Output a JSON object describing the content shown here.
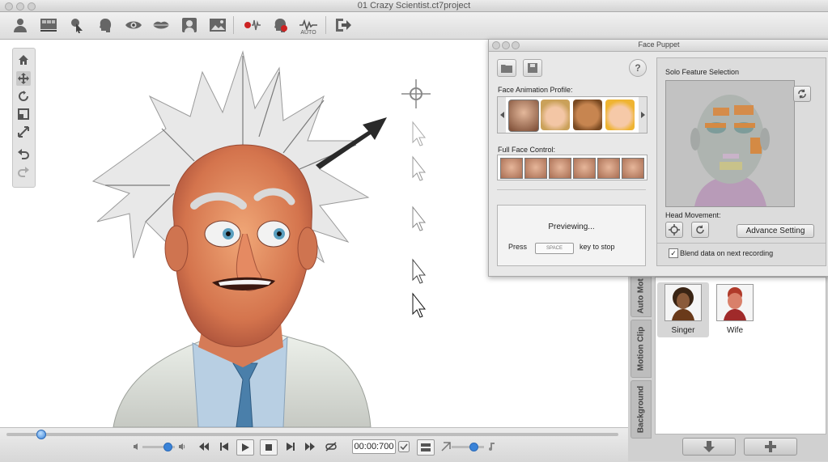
{
  "window": {
    "title": "01 Crazy Scientist.ct7project"
  },
  "toolbar": {
    "icons": [
      "actor-icon",
      "scene-icon",
      "pointer-puppet-icon",
      "head-icon",
      "eye-icon",
      "lips-icon",
      "portrait-icon",
      "image-icon",
      "voice-record-icon",
      "face-record-icon",
      "auto-lipsync-icon",
      "export-icon"
    ],
    "auto_label": "AUTO"
  },
  "left_tools": {
    "icons": [
      "home-icon",
      "move-icon",
      "rotate-icon",
      "scale-icon",
      "fit-icon",
      "undo-icon",
      "redo-icon"
    ]
  },
  "playback": {
    "time": "00:00:700",
    "progress": 0.055,
    "volume": 0.75,
    "speed": 0.65
  },
  "face_puppet": {
    "title": "Face Puppet",
    "help_label": "?",
    "profile_label": "Face Animation Profile:",
    "full_face_label": "Full Face Control:",
    "previewing_text": "Previewing...",
    "press_text": "Press",
    "space_key": "SPACE",
    "stop_text": "key to stop",
    "solo_label": "Solo Feature Selection",
    "head_movement_label": "Head Movement:",
    "advance_button": "Advance Setting",
    "blend_label": "Blend data on next recording",
    "blend_checked": true
  },
  "side_tabs": [
    "Auto Mot",
    "Motion Clip",
    "Background"
  ],
  "characters": [
    {
      "name": "Singer",
      "selected": true
    },
    {
      "name": "Wife",
      "selected": false
    }
  ],
  "colors": {
    "accent": "#3a83d8",
    "record_red": "#cc2222"
  }
}
